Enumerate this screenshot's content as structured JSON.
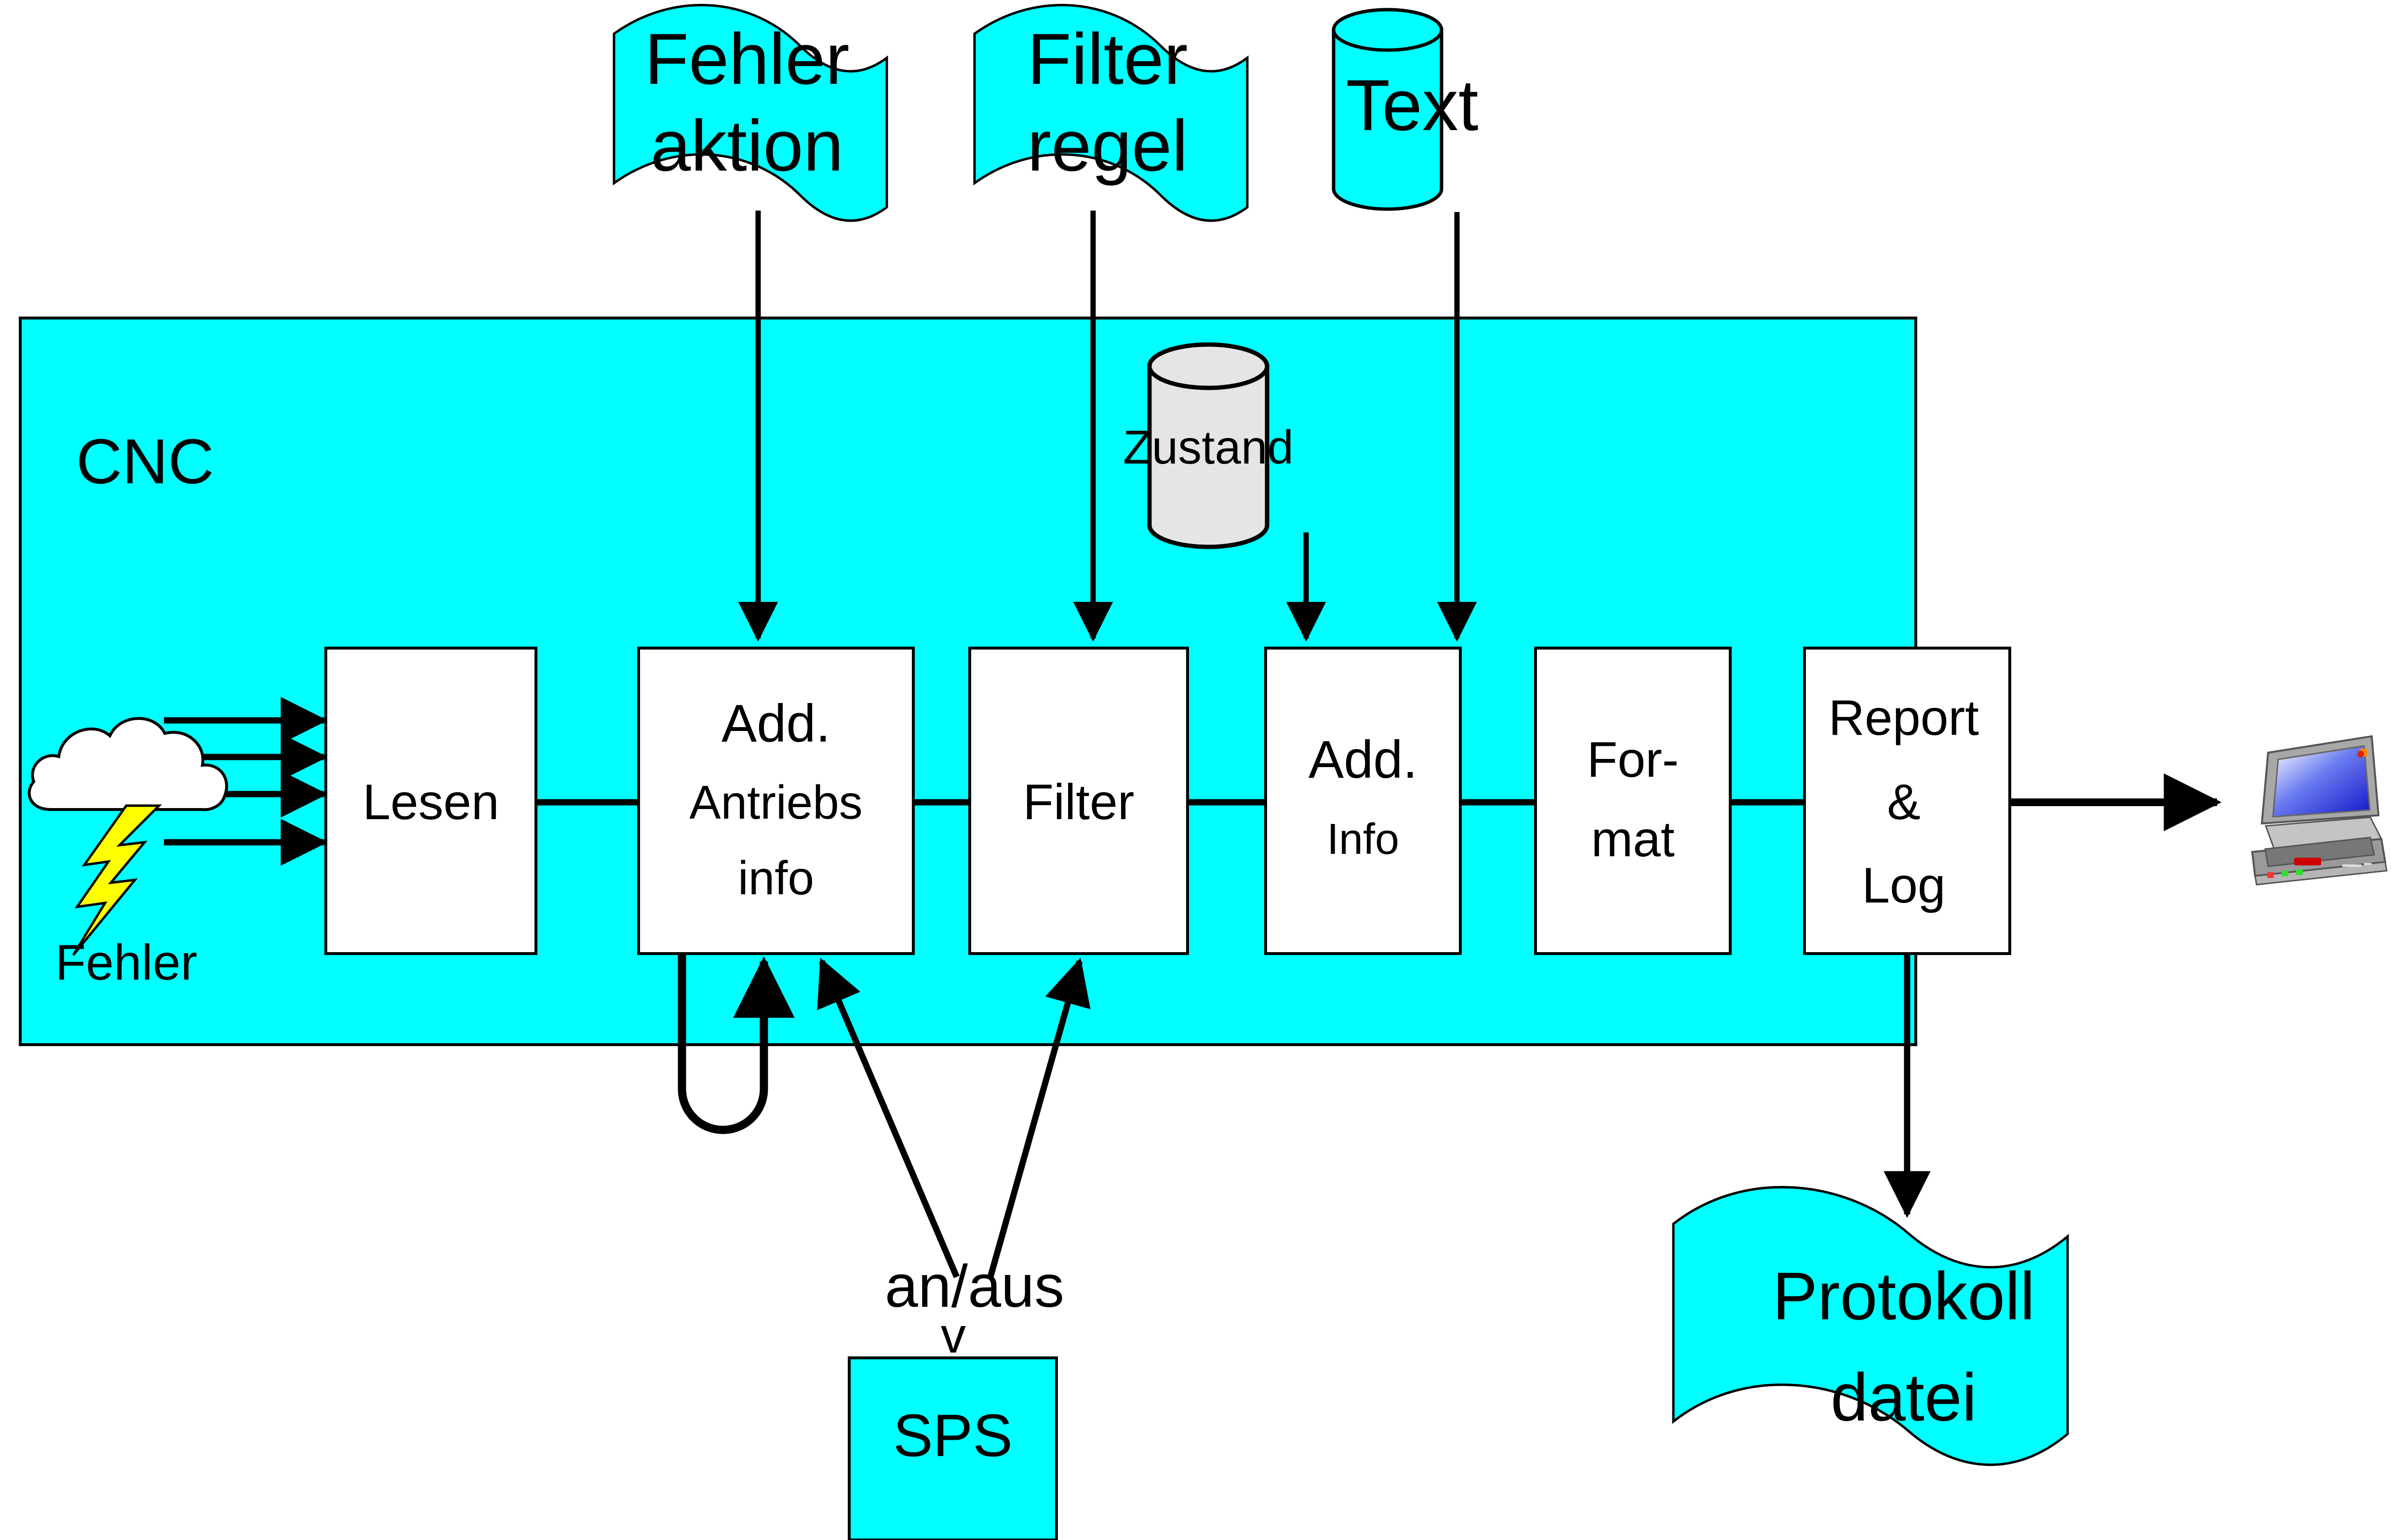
{
  "diagram": {
    "title_container": "CNC",
    "background_color": "#ffffff",
    "container_color": "#00ffff",
    "process_box_color": "#ffffff",
    "store_color": "#e5e5e5",
    "line_color": "#000000",
    "accent_yellow": "#ffff00"
  },
  "container": {
    "label": "CNC"
  },
  "external_inputs": [
    {
      "id": "fehler-aktion",
      "shape": "wavy-document",
      "line1": "Fehler",
      "line2": "aktion",
      "color": "#00ffff"
    },
    {
      "id": "filter-regel",
      "shape": "wavy-document",
      "line1": "Filter",
      "line2": "regel",
      "color": "#00ffff"
    },
    {
      "id": "text-store",
      "shape": "cylinder",
      "line1": "Text",
      "color": "#00ffff"
    }
  ],
  "internal_store": {
    "id": "zustand-store",
    "shape": "cylinder",
    "label": "Zustand",
    "color": "#e5e5e5"
  },
  "error_source": {
    "icon": "cloud-lightning-icon",
    "label": "Fehler",
    "arrow_count": 4,
    "cloud_color": "#ffffff",
    "bolt_color": "#ffff00"
  },
  "pipeline": [
    {
      "id": "lesen",
      "lines": [
        "Lesen"
      ],
      "emphasis": [
        false
      ]
    },
    {
      "id": "add-antriebs",
      "lines": [
        "Add.",
        "Antriebs",
        "info"
      ],
      "emphasis": [
        true,
        false,
        false
      ]
    },
    {
      "id": "filter",
      "lines": [
        "Filter"
      ],
      "emphasis": [
        false
      ]
    },
    {
      "id": "add-info",
      "lines": [
        "Add.",
        "Info"
      ],
      "emphasis": [
        true,
        false
      ]
    },
    {
      "id": "format",
      "lines": [
        "For-",
        "mat"
      ],
      "emphasis": [
        false,
        false
      ]
    },
    {
      "id": "report-log",
      "lines": [
        "Report",
        "&",
        "Log"
      ],
      "emphasis": [
        false,
        false,
        false
      ]
    }
  ],
  "output_device": {
    "id": "laptop",
    "icon": "laptop-icon",
    "screen_color": "#2222dd",
    "body_color": "#a0a0a0"
  },
  "control": {
    "id": "sps",
    "label": "SPS",
    "signal_label": "an/aus",
    "chevron": "v",
    "color": "#00ffff"
  },
  "output_file": {
    "id": "protokoll-datei",
    "shape": "wavy-document",
    "line1": "Protokoll",
    "line2": "datei",
    "color": "#00ffff"
  }
}
